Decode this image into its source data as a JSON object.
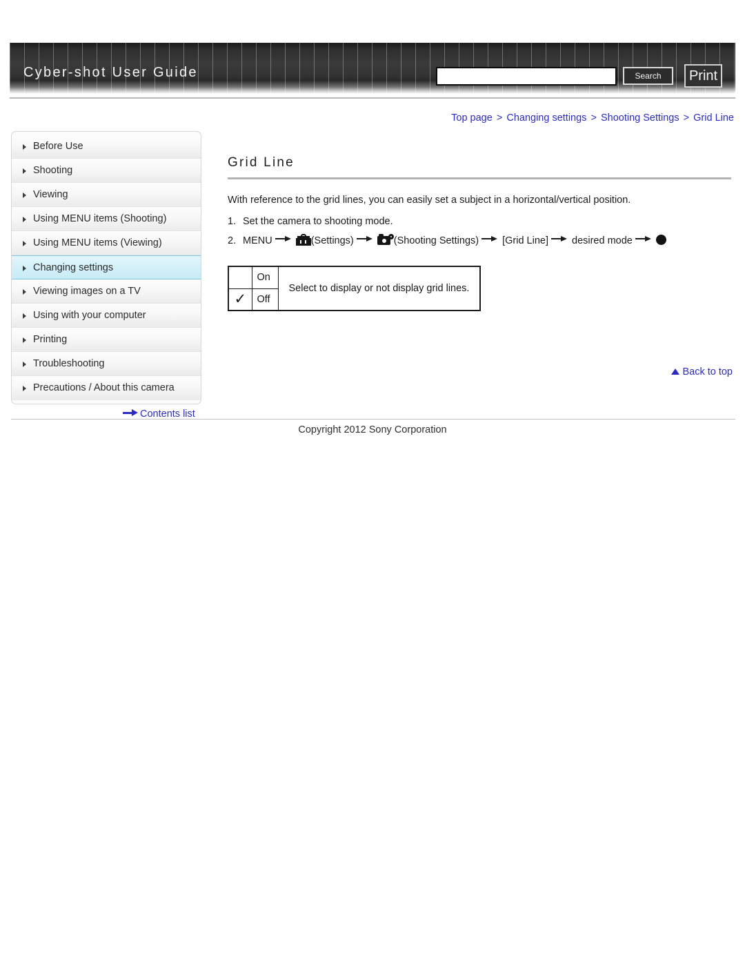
{
  "header": {
    "site_title": "Cyber-shot User Guide",
    "search": {
      "value": "",
      "placeholder": ""
    },
    "search_label": "Search",
    "print_label": "Print"
  },
  "breadcrumb": {
    "items": [
      "Top page",
      "Changing settings",
      "Shooting Settings",
      "Grid Line"
    ],
    "separator": ">"
  },
  "sidebar": {
    "items": [
      {
        "label": "Before Use",
        "active": false
      },
      {
        "label": "Shooting",
        "active": false
      },
      {
        "label": "Viewing",
        "active": false
      },
      {
        "label": "Using MENU items (Shooting)",
        "active": false
      },
      {
        "label": "Using MENU items (Viewing)",
        "active": false
      },
      {
        "label": "Changing settings",
        "active": true
      },
      {
        "label": "Viewing images on a TV",
        "active": false
      },
      {
        "label": "Using with your computer",
        "active": false
      },
      {
        "label": "Printing",
        "active": false
      },
      {
        "label": "Troubleshooting",
        "active": false
      },
      {
        "label": "Precautions / About this camera",
        "active": false
      }
    ],
    "contents_list_label": "Contents list"
  },
  "main": {
    "title": "Grid Line",
    "intro": "With reference to the grid lines, you can easily set a subject in a horizontal/vertical position.",
    "steps": [
      {
        "num": "1.",
        "text": "Set the camera to shooting mode."
      }
    ],
    "step2": {
      "num": "2.",
      "menu": "MENU",
      "settings_label": "(Settings)",
      "shooting_settings_label": "(Shooting Settings)",
      "item_label": "[Grid Line]",
      "desired_mode_label": "desired mode"
    },
    "table": {
      "rows": [
        {
          "mark": "",
          "option": "On"
        },
        {
          "mark": "✓",
          "option": "Off"
        }
      ],
      "description": "Select to display or not display grid lines."
    }
  },
  "footer": {
    "back_to_top": "Back to top",
    "copyright": "Copyright 2012 Sony Corporation"
  },
  "colors": {
    "link": "#2b2bbf",
    "active_nav": "#c8ecf6",
    "header_dark": "#2f2f2f"
  }
}
